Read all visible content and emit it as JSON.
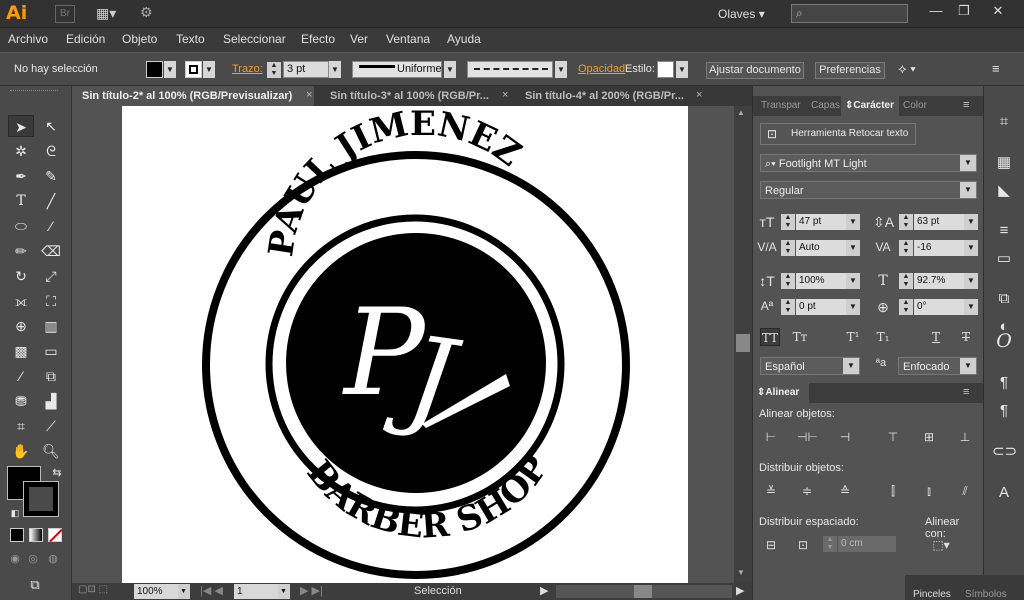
{
  "app": {
    "logo": "Ai",
    "bridge": "Br",
    "workspace": "Olaves",
    "search_placeholder": "",
    "window_buttons": [
      "—",
      "❐",
      "✕"
    ]
  },
  "menu": [
    "Archivo",
    "Edición",
    "Objeto",
    "Texto",
    "Seleccionar",
    "Efecto",
    "Ver",
    "Ventana",
    "Ayuda"
  ],
  "control": {
    "selection_status": "No hay selección",
    "stroke_label": "Trazo:",
    "stroke_value": "3 pt",
    "stroke_profile": "Uniforme",
    "opacity_label": "Opacidad",
    "style_label": "Estilo:",
    "align_doc_button": "Ajustar documento",
    "prefs_button": "Preferencias"
  },
  "tabs": [
    {
      "label": "Sin título-2* al 100% (RGB/Previsualizar)",
      "active": true
    },
    {
      "label": "Sin título-3* al 100% (RGB/Pr...",
      "active": false
    },
    {
      "label": "Sin título-4* al 200% (RGB/Pr...",
      "active": false
    }
  ],
  "artwork": {
    "top_text": "PAUL JIMENEZ",
    "bottom_text": "BARBER SHOP",
    "monogram_p": "P",
    "monogram_j": "J"
  },
  "status": {
    "zoom": "100%",
    "page": "1",
    "tool": "Selección"
  },
  "character_panel": {
    "tabs": [
      "Transpar",
      "Capas",
      "Carácter",
      "Color"
    ],
    "touch_type_button": "Herramienta Retocar texto",
    "font_family": "Footlight MT Light",
    "font_style": "Regular",
    "font_size": "47 pt",
    "leading": "63 pt",
    "kerning": "Auto",
    "tracking": "-16",
    "vertical_scale": "100%",
    "horizontal_scale": "92.7%",
    "baseline_shift": "0 pt",
    "rotation": "0°",
    "language": "Español",
    "antialias": "Enfocado"
  },
  "align_panel": {
    "title": "Alinear",
    "align_objects_label": "Alinear objetos:",
    "distribute_objects_label": "Distribuir objetos:",
    "distribute_spacing_label": "Distribuir espaciado:",
    "align_to_label": "Alinear con:",
    "spacing_value": "0 cm"
  },
  "bottom_dock": [
    "Pinceles",
    "Símbolos"
  ]
}
